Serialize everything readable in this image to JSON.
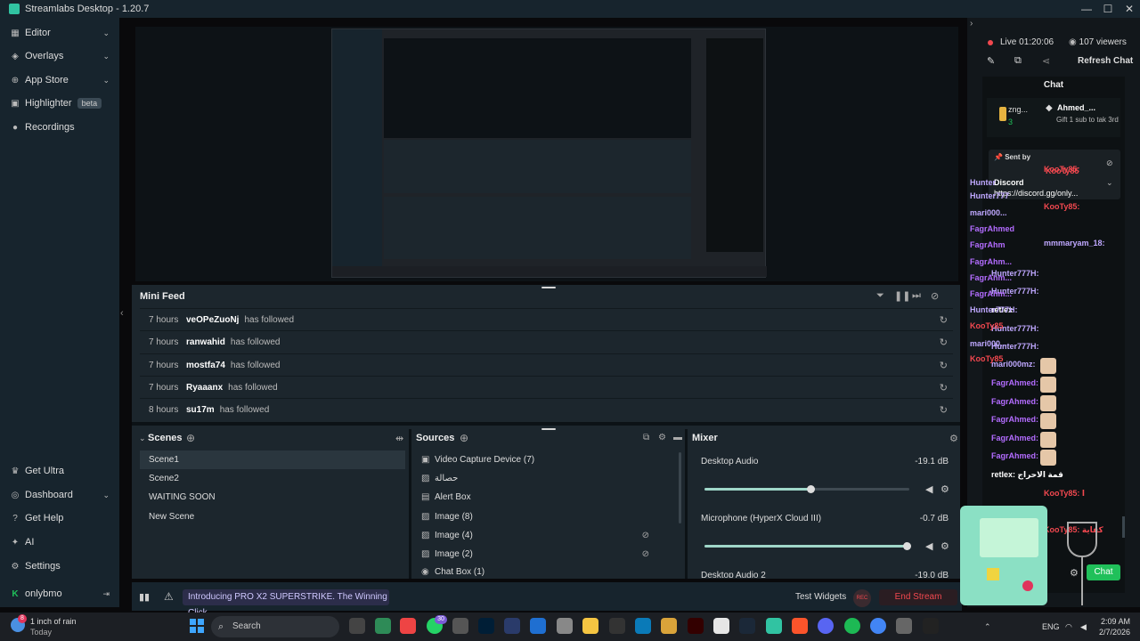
{
  "app": {
    "title": "Streamlabs Desktop - 1.20.7"
  },
  "sidebar": {
    "items": [
      {
        "label": "Editor",
        "icon": "editor-icon",
        "chevron": true
      },
      {
        "label": "Overlays",
        "icon": "overlays-icon",
        "chevron": true
      },
      {
        "label": "App Store",
        "icon": "app-store-icon",
        "chevron": true
      },
      {
        "label": "Highlighter",
        "icon": "highlighter-icon",
        "badge": "beta"
      },
      {
        "label": "Recordings",
        "icon": "recordings-icon"
      }
    ],
    "bottom_items": [
      {
        "label": "Get Ultra",
        "icon": "ultra-icon"
      },
      {
        "label": "Dashboard",
        "icon": "dashboard-icon",
        "chevron": true
      },
      {
        "label": "Get Help",
        "icon": "help-icon"
      },
      {
        "label": "AI",
        "icon": "ai-icon"
      },
      {
        "label": "Settings",
        "icon": "settings-icon"
      }
    ],
    "user": "onlybmo"
  },
  "minifeed": {
    "title": "Mini Feed",
    "rows": [
      {
        "time": "7 hours",
        "name": "veOPeZuoNj",
        "action": "has followed"
      },
      {
        "time": "7 hours",
        "name": "ranwahid",
        "action": "has followed"
      },
      {
        "time": "7 hours",
        "name": "mostfa74",
        "action": "has followed"
      },
      {
        "time": "7 hours",
        "name": "Ryaaanx",
        "action": "has followed"
      },
      {
        "time": "8 hours",
        "name": "su17m",
        "action": "has followed"
      }
    ]
  },
  "scenes": {
    "title": "Scenes",
    "items": [
      "Scene1",
      "Scene2",
      "WAITING SOON",
      "New Scene"
    ],
    "selected": 0
  },
  "sources": {
    "title": "Sources",
    "items": [
      {
        "label": "Video Capture Device (7)",
        "icon": "camera-icon"
      },
      {
        "label": "حصالة",
        "icon": "image-icon"
      },
      {
        "label": "Alert Box",
        "icon": "alert-icon"
      },
      {
        "label": "Image (8)",
        "icon": "image-icon"
      },
      {
        "label": "Image (4)",
        "icon": "image-icon",
        "hidden": true
      },
      {
        "label": "Image (2)",
        "icon": "image-icon",
        "hidden": true
      },
      {
        "label": "Chat Box (1)",
        "icon": "chat-icon"
      }
    ]
  },
  "mixer": {
    "title": "Mixer",
    "channels": [
      {
        "name": "Desktop Audio",
        "db": "-19.1 dB",
        "level": 0.52
      },
      {
        "name": "Microphone (HyperX Cloud III)",
        "db": "-0.7 dB",
        "level": 0.99
      },
      {
        "name": "Desktop Audio 2",
        "db": "-19.0 dB",
        "level": 0.5
      }
    ]
  },
  "footer": {
    "promo": "Introducing PRO X2 SUPERSTRIKE. The Winning Click.",
    "test_widgets": "Test Widgets",
    "end_stream": "End Stream",
    "rec": "REC"
  },
  "stream": {
    "status": "Live",
    "time": "01:20:06",
    "viewers": "107 viewers",
    "refresh": "Refresh Chat"
  },
  "chat": {
    "title": "Chat",
    "send": "Chat",
    "top_gifter": {
      "name": "zng...",
      "count": "3"
    },
    "gift": {
      "name": "Ahmed_...",
      "text": "Gift 1 sub to tak 3rd"
    },
    "pinned": {
      "label": "Sent by",
      "user": "KooTy85",
      "discord_label": "Discord",
      "link": "https://discord.gg/only..."
    },
    "messages": [
      {
        "user": "KooTy85:",
        "color": "#f2484f"
      },
      {
        "user": "KooTy85:",
        "color": "#f2484f"
      },
      {
        "user": "mmmaryam_18:",
        "color": "#bfa8ff"
      },
      {
        "user": "Hunter777H:",
        "color": "#bfa8ff"
      },
      {
        "user": "Hunter777H:",
        "color": "#bfa8ff"
      },
      {
        "user": "retlex",
        "color": "#ffffff"
      },
      {
        "user": "Hunter777H:",
        "color": "#bfa8ff"
      },
      {
        "user": "Hunter777H:",
        "color": "#bfa8ff"
      },
      {
        "user": "mari000mz:",
        "color": "#bfa8ff"
      },
      {
        "user": "FagrAhmed:",
        "color": "#b36cff"
      },
      {
        "user": "FagrAhmed:",
        "color": "#b36cff"
      },
      {
        "user": "FagrAhmed:",
        "color": "#b36cff"
      },
      {
        "user": "FagrAhmed:",
        "color": "#b36cff"
      },
      {
        "user": "FagrAhmed:",
        "color": "#b36cff"
      },
      {
        "user": "retlex: قمة الاحراج",
        "color": "#ffffff"
      },
      {
        "user": "KooTy85: ا",
        "color": "#f2484f"
      },
      {
        "user": "KooTy85: كفاية",
        "color": "#f2484f"
      }
    ],
    "side_names": [
      "Hunter",
      "Hunter777",
      "mari000...",
      "FagrAhmed",
      "FagrAhm",
      "FagrAhm...",
      "FagrAhm...",
      "FagrAhm...",
      "Hunter777H:",
      "KooTy85",
      "mari000...",
      "KooTy85"
    ]
  },
  "taskbar": {
    "weather": "1 inch of rain",
    "weather_sub": "Today",
    "search": "Search",
    "lang": "ENG",
    "time": "2:09 AM",
    "date": "2/7/2026",
    "notif": "8",
    "teams_badge": "30"
  },
  "colors": {
    "accent": "#31c3a2",
    "danger": "#f2484f",
    "chat_green": "#20c05a"
  }
}
